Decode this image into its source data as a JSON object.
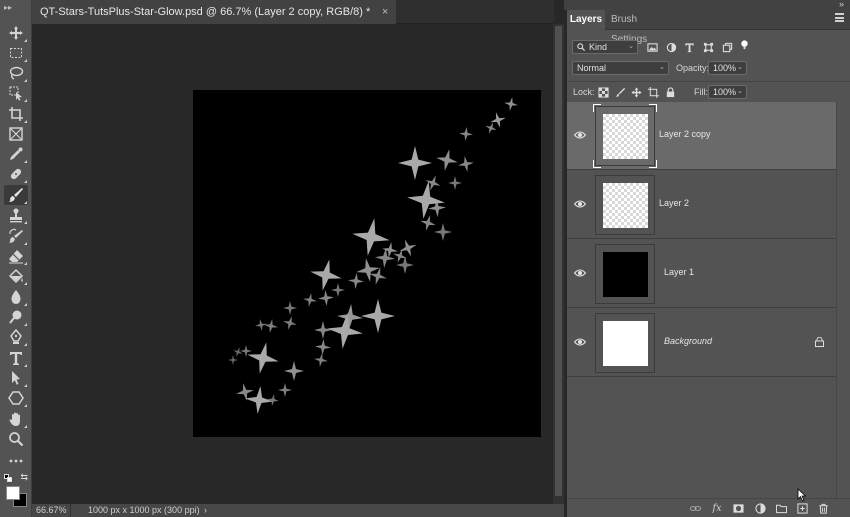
{
  "document": {
    "tab_title": "QT-Stars-TutsPlus-Star-Glow.psd @ 66.7% (Layer 2 copy, RGB/8) *",
    "close_glyph": "×"
  },
  "status_bar": {
    "zoom": "66.67%",
    "doc_info": "1000 px x 1000 px (300 ppi)",
    "arrow": "›"
  },
  "panel": {
    "tabs": [
      {
        "label": "Layers",
        "active": true
      },
      {
        "label": "Brush Settings",
        "active": false
      }
    ],
    "filter": {
      "label": "Kind"
    },
    "blend_mode": "Normal",
    "opacity_label": "Opacity:",
    "opacity_value": "100%",
    "lock_label": "Lock:",
    "fill_label": "Fill:",
    "fill_value": "100%"
  },
  "layers": [
    {
      "name": "Layer 2 copy",
      "thumb": "transparent",
      "selected": true,
      "visible": true
    },
    {
      "name": "Layer 2",
      "thumb": "transparent",
      "selected": false,
      "visible": true
    },
    {
      "name": "Layer 1",
      "thumb": "black",
      "selected": false,
      "visible": true
    },
    {
      "name": "Background",
      "thumb": "white",
      "selected": false,
      "visible": true,
      "locked": true,
      "italic": true
    }
  ],
  "tools": [
    "move-tool",
    "marquee-tool",
    "lasso-tool",
    "object-selection-tool",
    "crop-tool",
    "frame-tool",
    "eyedropper-tool",
    "healing-brush-tool",
    "brush-tool",
    "clone-stamp-tool",
    "history-brush-tool",
    "eraser-tool",
    "paint-bucket-tool",
    "blur-tool",
    "dodge-tool",
    "pen-tool",
    "type-tool",
    "path-selection-tool",
    "shape-tool",
    "hand-tool",
    "zoom-tool",
    "more-tools"
  ],
  "colors": {
    "foreground": "#ffffff",
    "background": "#000000",
    "accent_selected_layer": "#6a6a6a",
    "canvas": "#000000",
    "star": "#a9a9a9"
  }
}
